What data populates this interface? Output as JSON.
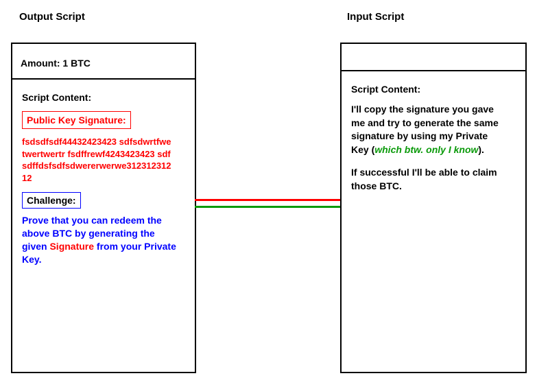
{
  "titles": {
    "output": "Output Script",
    "input": "Input Script"
  },
  "output_box": {
    "amount_line": "Amount: 1 BTC",
    "script_content_label": "Script Content:",
    "public_key_sig_label": "Public Key Signature:",
    "signature_data": "fsdsdfsdf44432423423 sdfsdwrtfwetwertwertr fsdffrewf4243423423 sdfsdffdsfsdfsdwererwerwe31231231212",
    "challenge_label": "Challenge:",
    "challenge_text_pre": "Prove that you can redeem the above BTC by generating the given ",
    "challenge_text_sig_word": "Signature",
    "challenge_text_post": " from your Private Key."
  },
  "input_box": {
    "script_content_label": "Script Content:",
    "para1_pre": "I'll copy the signature you gave me and try to generate the same signature by using my Private Key (",
    "para1_green": "which btw. only I know",
    "para1_post": ").",
    "para2": "If successful I'll be able to claim those BTC."
  }
}
